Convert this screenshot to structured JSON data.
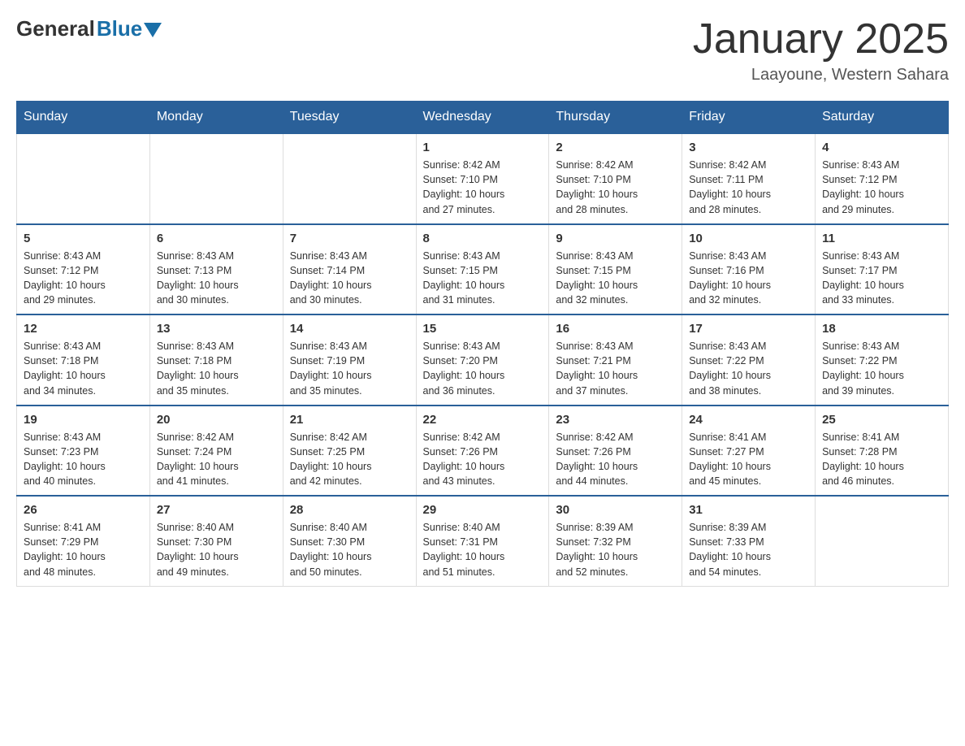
{
  "header": {
    "logo": {
      "general": "General",
      "blue": "Blue"
    },
    "title": "January 2025",
    "location": "Laayoune, Western Sahara"
  },
  "days_of_week": [
    "Sunday",
    "Monday",
    "Tuesday",
    "Wednesday",
    "Thursday",
    "Friday",
    "Saturday"
  ],
  "weeks": [
    [
      {
        "day": "",
        "info": ""
      },
      {
        "day": "",
        "info": ""
      },
      {
        "day": "",
        "info": ""
      },
      {
        "day": "1",
        "info": "Sunrise: 8:42 AM\nSunset: 7:10 PM\nDaylight: 10 hours\nand 27 minutes."
      },
      {
        "day": "2",
        "info": "Sunrise: 8:42 AM\nSunset: 7:10 PM\nDaylight: 10 hours\nand 28 minutes."
      },
      {
        "day": "3",
        "info": "Sunrise: 8:42 AM\nSunset: 7:11 PM\nDaylight: 10 hours\nand 28 minutes."
      },
      {
        "day": "4",
        "info": "Sunrise: 8:43 AM\nSunset: 7:12 PM\nDaylight: 10 hours\nand 29 minutes."
      }
    ],
    [
      {
        "day": "5",
        "info": "Sunrise: 8:43 AM\nSunset: 7:12 PM\nDaylight: 10 hours\nand 29 minutes."
      },
      {
        "day": "6",
        "info": "Sunrise: 8:43 AM\nSunset: 7:13 PM\nDaylight: 10 hours\nand 30 minutes."
      },
      {
        "day": "7",
        "info": "Sunrise: 8:43 AM\nSunset: 7:14 PM\nDaylight: 10 hours\nand 30 minutes."
      },
      {
        "day": "8",
        "info": "Sunrise: 8:43 AM\nSunset: 7:15 PM\nDaylight: 10 hours\nand 31 minutes."
      },
      {
        "day": "9",
        "info": "Sunrise: 8:43 AM\nSunset: 7:15 PM\nDaylight: 10 hours\nand 32 minutes."
      },
      {
        "day": "10",
        "info": "Sunrise: 8:43 AM\nSunset: 7:16 PM\nDaylight: 10 hours\nand 32 minutes."
      },
      {
        "day": "11",
        "info": "Sunrise: 8:43 AM\nSunset: 7:17 PM\nDaylight: 10 hours\nand 33 minutes."
      }
    ],
    [
      {
        "day": "12",
        "info": "Sunrise: 8:43 AM\nSunset: 7:18 PM\nDaylight: 10 hours\nand 34 minutes."
      },
      {
        "day": "13",
        "info": "Sunrise: 8:43 AM\nSunset: 7:18 PM\nDaylight: 10 hours\nand 35 minutes."
      },
      {
        "day": "14",
        "info": "Sunrise: 8:43 AM\nSunset: 7:19 PM\nDaylight: 10 hours\nand 35 minutes."
      },
      {
        "day": "15",
        "info": "Sunrise: 8:43 AM\nSunset: 7:20 PM\nDaylight: 10 hours\nand 36 minutes."
      },
      {
        "day": "16",
        "info": "Sunrise: 8:43 AM\nSunset: 7:21 PM\nDaylight: 10 hours\nand 37 minutes."
      },
      {
        "day": "17",
        "info": "Sunrise: 8:43 AM\nSunset: 7:22 PM\nDaylight: 10 hours\nand 38 minutes."
      },
      {
        "day": "18",
        "info": "Sunrise: 8:43 AM\nSunset: 7:22 PM\nDaylight: 10 hours\nand 39 minutes."
      }
    ],
    [
      {
        "day": "19",
        "info": "Sunrise: 8:43 AM\nSunset: 7:23 PM\nDaylight: 10 hours\nand 40 minutes."
      },
      {
        "day": "20",
        "info": "Sunrise: 8:42 AM\nSunset: 7:24 PM\nDaylight: 10 hours\nand 41 minutes."
      },
      {
        "day": "21",
        "info": "Sunrise: 8:42 AM\nSunset: 7:25 PM\nDaylight: 10 hours\nand 42 minutes."
      },
      {
        "day": "22",
        "info": "Sunrise: 8:42 AM\nSunset: 7:26 PM\nDaylight: 10 hours\nand 43 minutes."
      },
      {
        "day": "23",
        "info": "Sunrise: 8:42 AM\nSunset: 7:26 PM\nDaylight: 10 hours\nand 44 minutes."
      },
      {
        "day": "24",
        "info": "Sunrise: 8:41 AM\nSunset: 7:27 PM\nDaylight: 10 hours\nand 45 minutes."
      },
      {
        "day": "25",
        "info": "Sunrise: 8:41 AM\nSunset: 7:28 PM\nDaylight: 10 hours\nand 46 minutes."
      }
    ],
    [
      {
        "day": "26",
        "info": "Sunrise: 8:41 AM\nSunset: 7:29 PM\nDaylight: 10 hours\nand 48 minutes."
      },
      {
        "day": "27",
        "info": "Sunrise: 8:40 AM\nSunset: 7:30 PM\nDaylight: 10 hours\nand 49 minutes."
      },
      {
        "day": "28",
        "info": "Sunrise: 8:40 AM\nSunset: 7:30 PM\nDaylight: 10 hours\nand 50 minutes."
      },
      {
        "day": "29",
        "info": "Sunrise: 8:40 AM\nSunset: 7:31 PM\nDaylight: 10 hours\nand 51 minutes."
      },
      {
        "day": "30",
        "info": "Sunrise: 8:39 AM\nSunset: 7:32 PM\nDaylight: 10 hours\nand 52 minutes."
      },
      {
        "day": "31",
        "info": "Sunrise: 8:39 AM\nSunset: 7:33 PM\nDaylight: 10 hours\nand 54 minutes."
      },
      {
        "day": "",
        "info": ""
      }
    ]
  ]
}
